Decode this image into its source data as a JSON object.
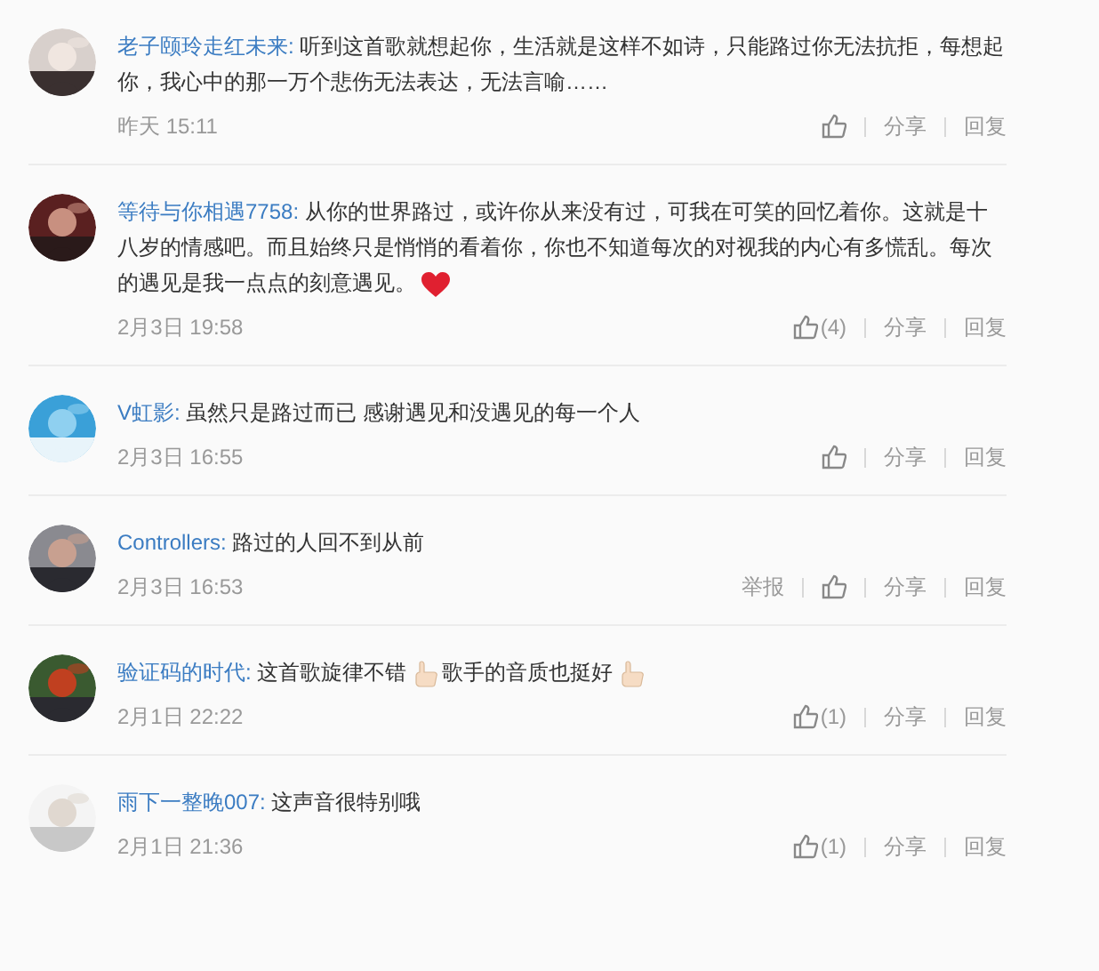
{
  "comments": [
    {
      "author": "老子颐玲走红未来:",
      "body": [
        {
          "kind": "text",
          "text": "听到这首歌就想起你，生活就是这样不如诗，只能路过你无法抗拒，每想起你，我心中的那一万个悲伤无法表达，无法言喻……"
        }
      ],
      "time": "昨天 15:11",
      "actions": [
        "分享",
        "回复"
      ]
    },
    {
      "author": "等待与你相遇7758:",
      "body": [
        {
          "kind": "text",
          "text": "从你的世界路过，或许你从来没有过，可我在可笑的回忆着你。这就是十八岁的情感吧。而且始终只是悄悄的看着你，你也不知道每次的对视我的内心有多慌乱。每次的遇见是我一点点的刻意遇见。"
        },
        {
          "kind": "heart"
        }
      ],
      "time": "2月3日 19:58",
      "like_count": "(4)",
      "actions": [
        "分享",
        "回复"
      ]
    },
    {
      "author": "V虹影:",
      "body": [
        {
          "kind": "text",
          "text": "虽然只是路过而已 感谢遇见和没遇见的每一个人"
        }
      ],
      "time": "2月3日 16:55",
      "actions": [
        "分享",
        "回复"
      ]
    },
    {
      "author": "Controllers:",
      "body": [
        {
          "kind": "text",
          "text": "路过的人回不到从前"
        }
      ],
      "time": "2月3日 16:53",
      "report": "举报",
      "actions": [
        "分享",
        "回复"
      ]
    },
    {
      "author": "验证码的时代:",
      "body": [
        {
          "kind": "text",
          "text": "这首歌旋律不错"
        },
        {
          "kind": "thumb"
        },
        {
          "kind": "text",
          "text": "歌手的音质也挺好"
        },
        {
          "kind": "thumb"
        }
      ],
      "time": "2月1日 22:22",
      "like_count": "(1)",
      "actions": [
        "分享",
        "回复"
      ]
    },
    {
      "author": "雨下一整晚007:",
      "body": [
        {
          "kind": "text",
          "text": "这声音很特别哦"
        }
      ],
      "time": "2月1日 21:36",
      "like_count": "(1)",
      "actions": [
        "分享",
        "回复"
      ]
    }
  ]
}
